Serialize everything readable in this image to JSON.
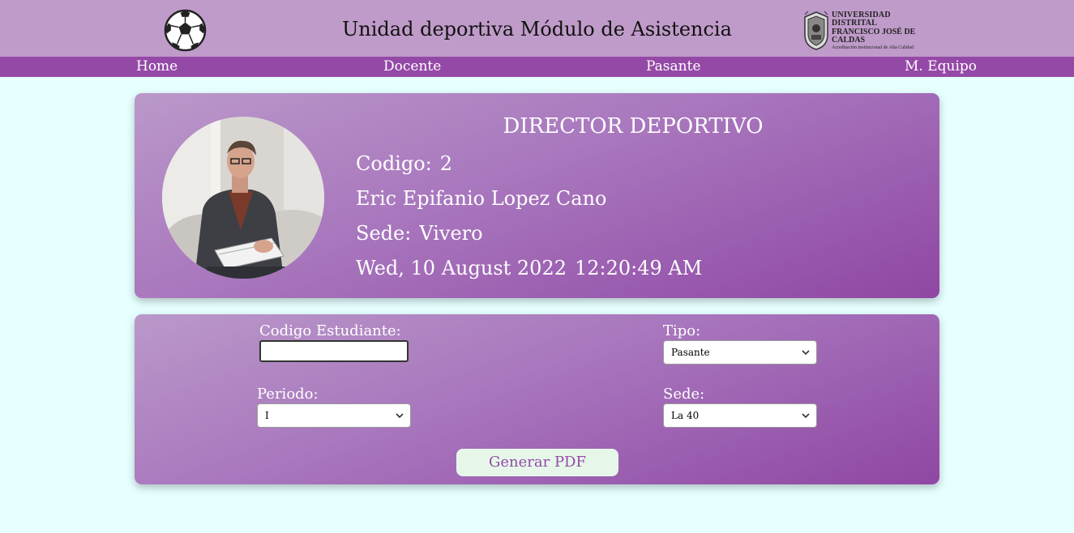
{
  "header": {
    "title": "Unidad deportiva Módulo de Asistencia",
    "logo": {
      "line1": "UNIVERSIDAD DISTRITAL",
      "line2": "FRANCISCO JOSÉ DE CALDAS",
      "line3": "Acreditación institucional de Alta Calidad"
    }
  },
  "nav": [
    "Home",
    "Docente",
    "Pasante",
    "M. Equipo"
  ],
  "profile": {
    "role": "DIRECTOR DEPORTIVO",
    "codigo_label": "Codigo:",
    "codigo_value": "2",
    "name": "Eric Epifanio Lopez Cano",
    "sede_label": "Sede:",
    "sede_value": "Vivero",
    "date": "Wed, 10 August 2022",
    "time": "12:20:49 AM"
  },
  "form": {
    "codigo_label": "Codigo Estudiante:",
    "codigo_value": "",
    "tipo_label": "Tipo:",
    "tipo_value": "Pasante",
    "periodo_label": "Periodo:",
    "periodo_value": "I",
    "sede_label": "Sede:",
    "sede_value": "La 40",
    "button_label": "Generar PDF"
  },
  "colors": {
    "header_bg": "#bf9bc9",
    "nav_bg": "#9549a7",
    "page_bg": "#e6ffff",
    "button_bg": "#e6f7ea"
  }
}
